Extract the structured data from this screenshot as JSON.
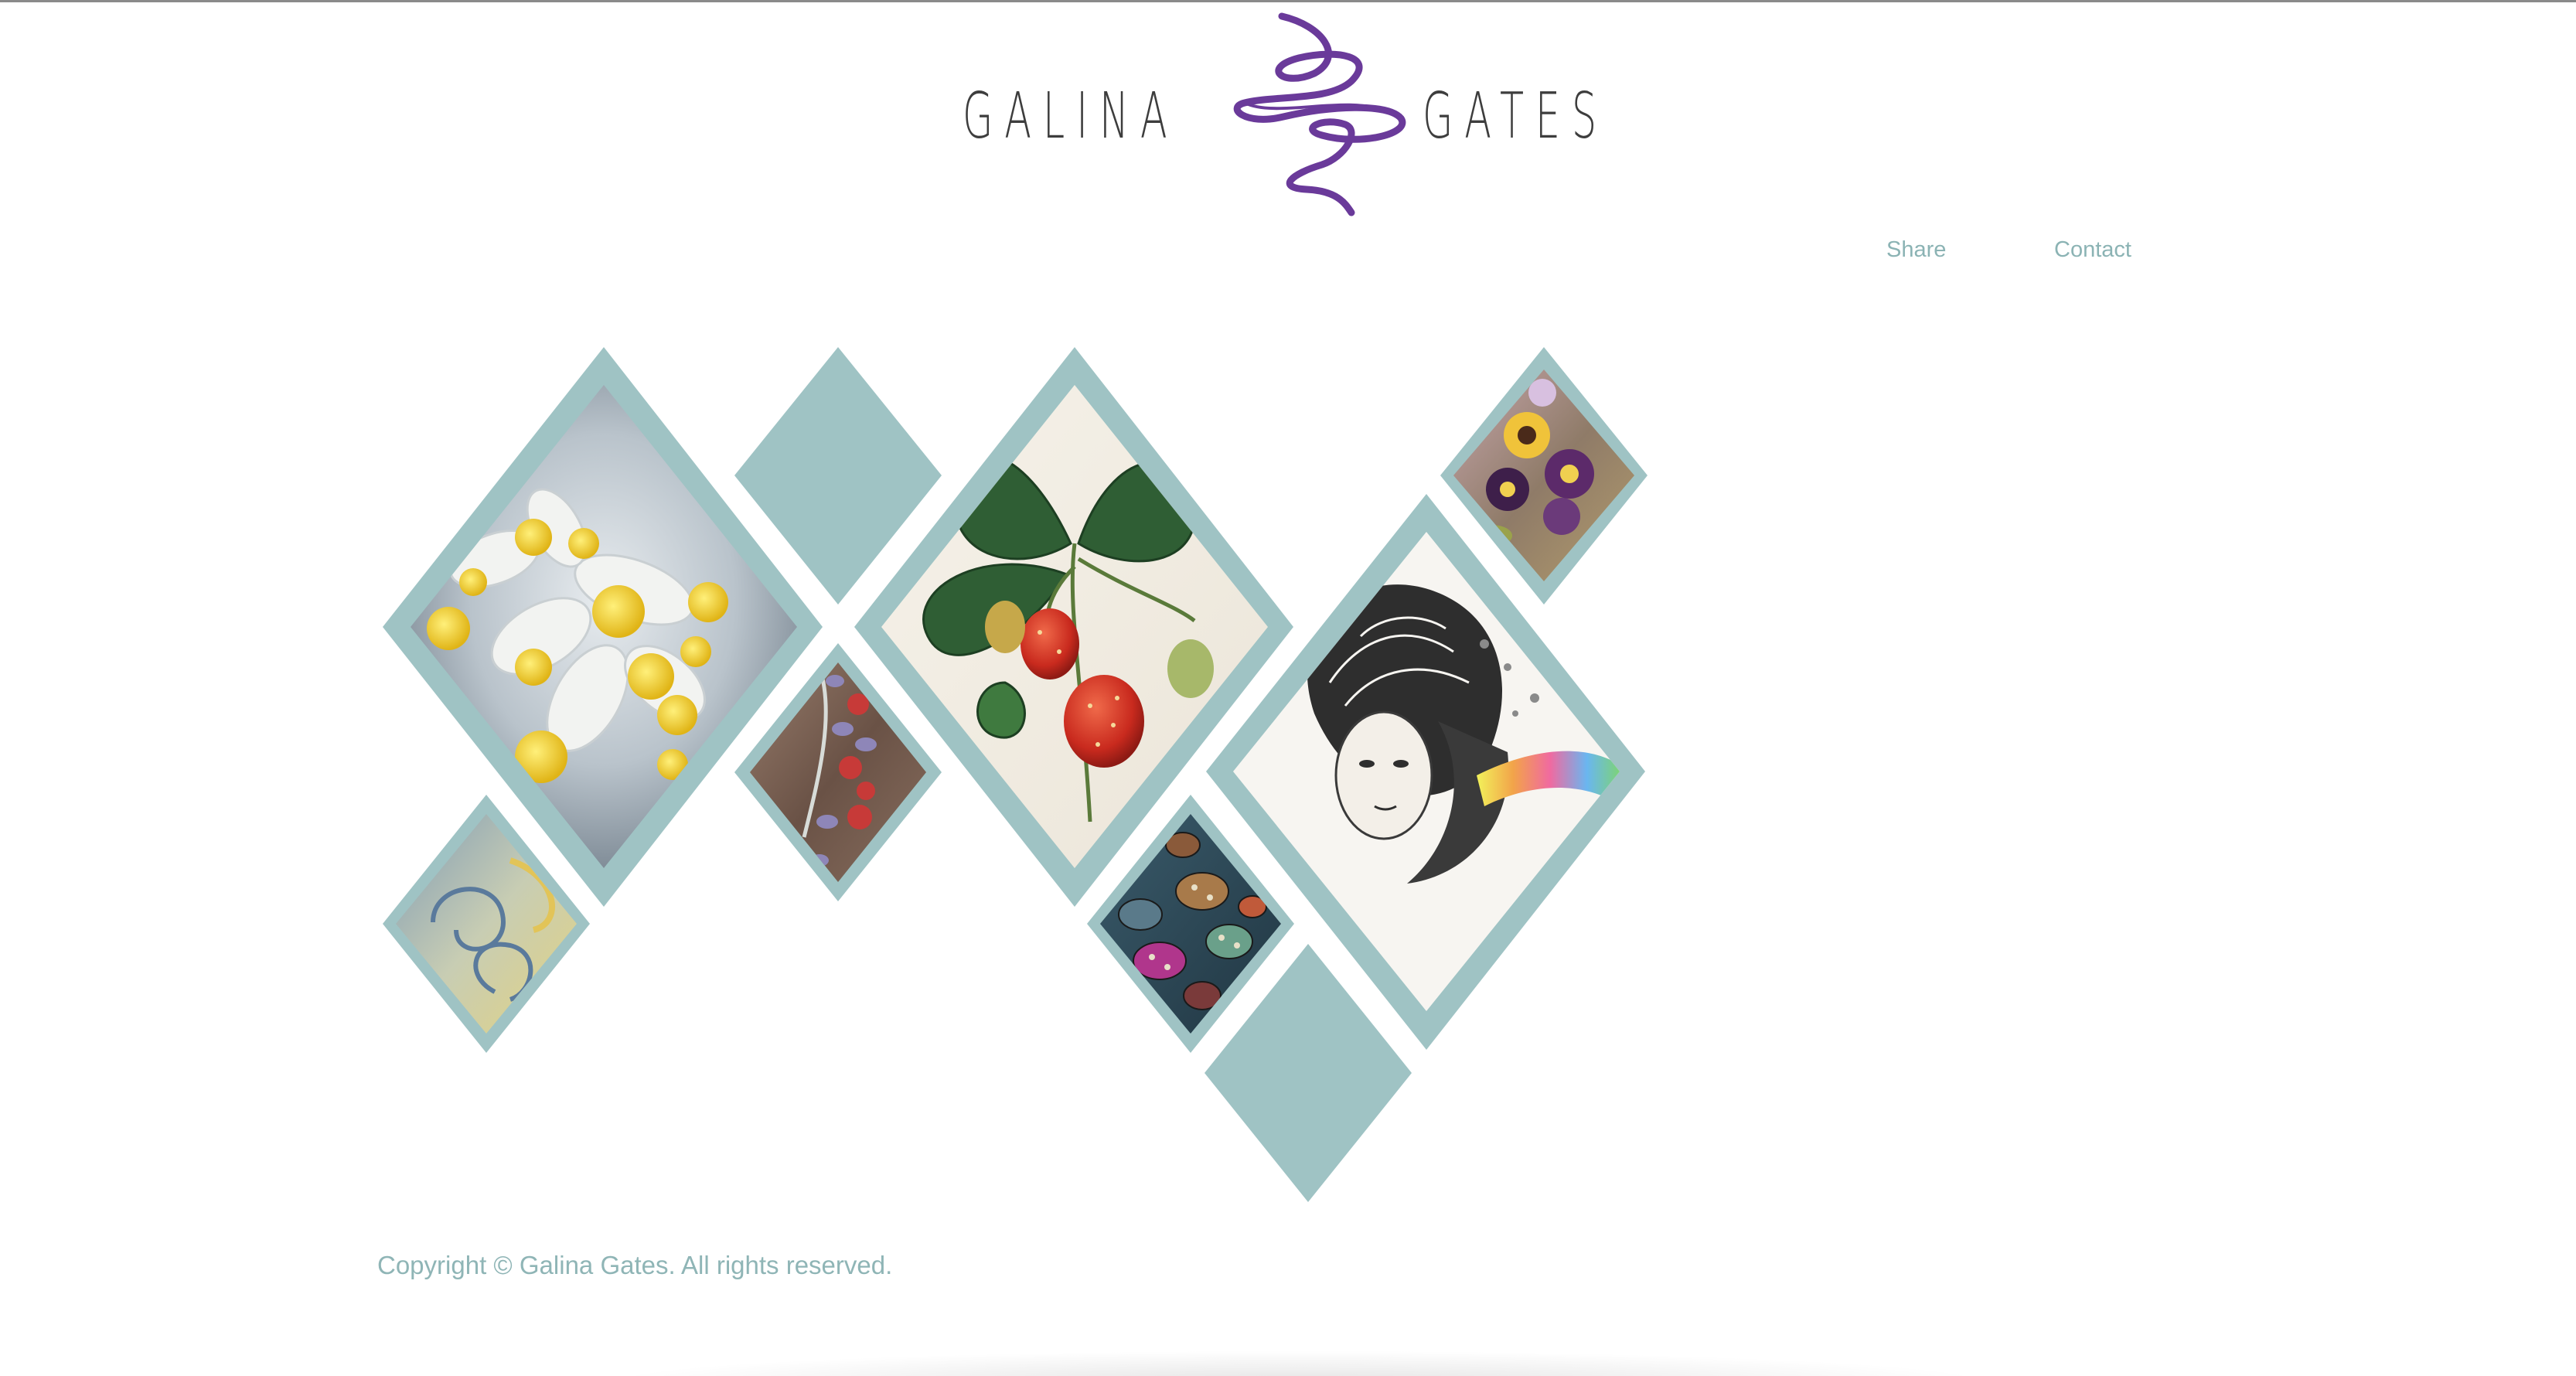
{
  "logo": {
    "left_word": "GALINA",
    "right_word": "GATES",
    "monogram_icon": "script-g-monogram-icon",
    "monogram_color": "#6a3a9a"
  },
  "nav": {
    "share_label": "Share",
    "contact_label": "Contact"
  },
  "colors": {
    "accent": "#9fc3c4",
    "nav_text": "#8bb3b4",
    "footer_text": "#8fb5b6"
  },
  "gallery": {
    "tiles": [
      {
        "name": "dusty-miller-flowers-tile",
        "image": "white-flowers-yellow-centers"
      },
      {
        "name": "plain-diamond-tile-top",
        "image": "none"
      },
      {
        "name": "strawberry-botanical-tile",
        "image": "strawberry-illustration"
      },
      {
        "name": "pansy-embroidery-tile",
        "image": "pansies"
      },
      {
        "name": "beaded-bracelet-tile",
        "image": "bead-bracelet"
      },
      {
        "name": "vintage-lady-drawing-tile",
        "image": "lady-with-rainbow"
      },
      {
        "name": "swirl-painting-tile",
        "image": "blue-yellow-swirls"
      },
      {
        "name": "decorated-beads-tile",
        "image": "painted-eggs-beads"
      },
      {
        "name": "plain-diamond-tile-bottom",
        "image": "none"
      }
    ]
  },
  "footer": {
    "copyright": "Copyright © Galina Gates. All rights reserved."
  }
}
